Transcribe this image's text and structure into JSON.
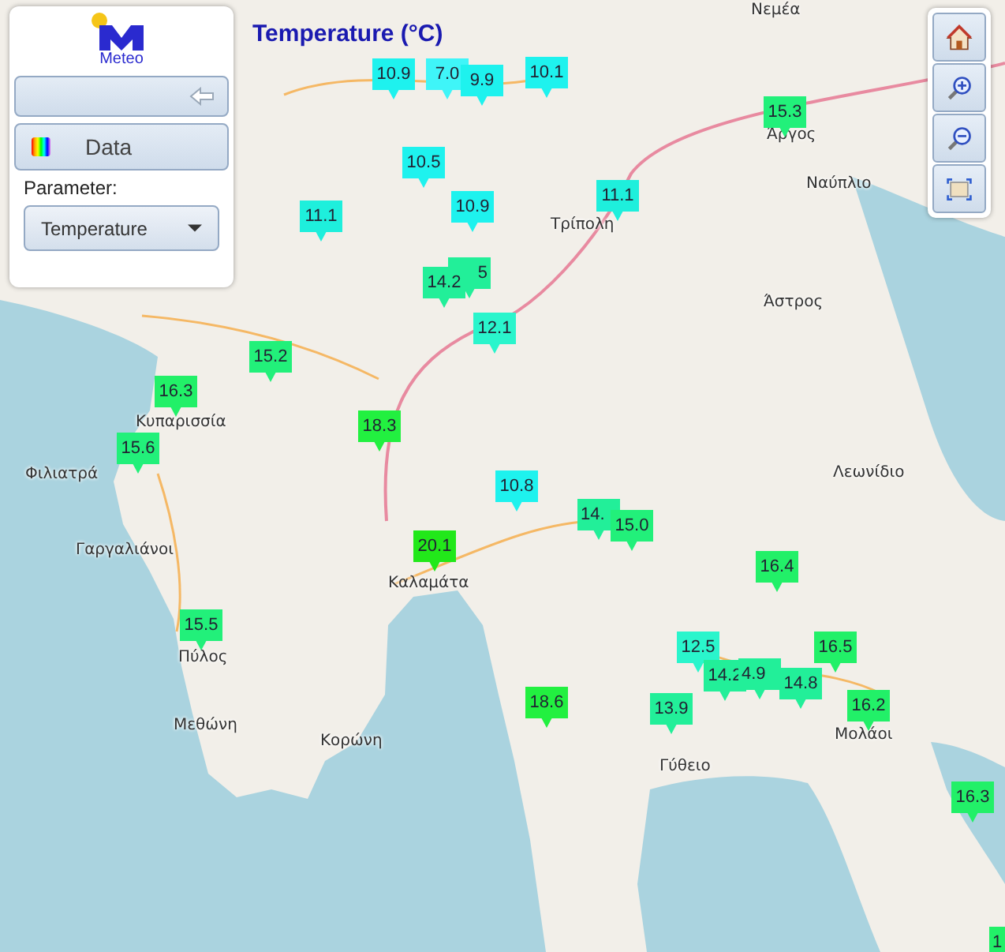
{
  "logo": {
    "text": "Meteo"
  },
  "panel": {
    "data_button": {
      "label": "Data"
    },
    "parameter": {
      "label": "Parameter:",
      "value": "Temperature"
    }
  },
  "map": {
    "title": "Temperature (°C)",
    "labels": [
      "Νεμέα",
      "Άργος",
      "Ναύπλιο",
      "Τρίπολη",
      "Άστρος",
      "Κυπαρισσία",
      "Λεωνίδιο",
      "Φιλιατρά",
      "Γαργαλιάνοι",
      "Καλαμάτα",
      "Πύλος",
      "Μεθώνη",
      "Μολάοι",
      "Κορώνη",
      "Γύθειο"
    ],
    "markers": [
      {
        "value": "10.9",
        "color": "#1ef2ee"
      },
      {
        "value": "7.0",
        "color": "#3ff5f8"
      },
      {
        "value": "9.9",
        "color": "#1ef2ee"
      },
      {
        "value": "10.1",
        "color": "#1ef2ee"
      },
      {
        "value": "15.3",
        "color": "#22f07a"
      },
      {
        "value": "10.5",
        "color": "#1ef2ee"
      },
      {
        "value": "10.9",
        "color": "#1ef2ee"
      },
      {
        "value": "11.1",
        "color": "#1eefdc"
      },
      {
        "value": "11.1",
        "color": "#1eefdc"
      },
      {
        "value": "5",
        "color": "#22ef99"
      },
      {
        "value": "14.2",
        "color": "#22ef99"
      },
      {
        "value": "12.1",
        "color": "#2af5cc"
      },
      {
        "value": "15.2",
        "color": "#22f07a"
      },
      {
        "value": "16.3",
        "color": "#22f068"
      },
      {
        "value": "18.3",
        "color": "#22f040"
      },
      {
        "value": "15.6",
        "color": "#22f07a"
      },
      {
        "value": "10.8",
        "color": "#1ef2ee"
      },
      {
        "value": "14.",
        "color": "#22ef99"
      },
      {
        "value": "15.0",
        "color": "#22f07a"
      },
      {
        "value": "20.1",
        "color": "#22e81a"
      },
      {
        "value": "16.4",
        "color": "#22f068"
      },
      {
        "value": "15.5",
        "color": "#22f07a"
      },
      {
        "value": "12.5",
        "color": "#2af5cc"
      },
      {
        "value": "16.5",
        "color": "#22f068"
      },
      {
        "value": "18.6",
        "color": "#22f040"
      },
      {
        "value": "14.2",
        "color": "#22ef99"
      },
      {
        "value": "4.9",
        "color": "#22ef99"
      },
      {
        "value": "14.8",
        "color": "#22ef99"
      },
      {
        "value": "13.9",
        "color": "#22ef99"
      },
      {
        "value": "16.2",
        "color": "#22f068"
      },
      {
        "value": "16.3",
        "color": "#22f068"
      },
      {
        "value": "1",
        "color": "#22f068"
      }
    ]
  }
}
